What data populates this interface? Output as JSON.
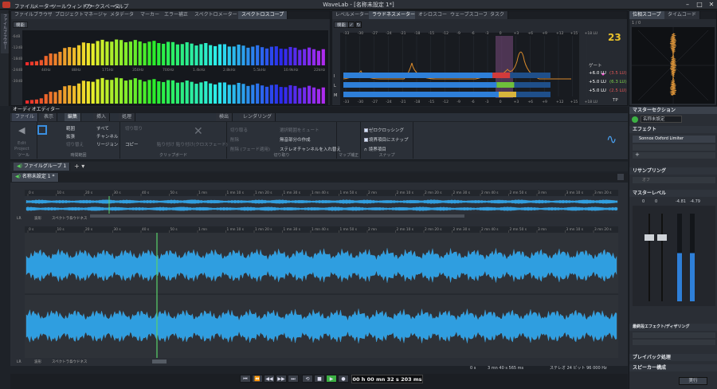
{
  "app": {
    "title": "WaveLab - [名称未設定 1*]"
  },
  "menu": [
    "ファイル",
    "メーター",
    "ツールウィンドウ",
    "ワークスペース",
    "ヘルプ"
  ],
  "side_strip": [
    "ファイルブラウザー"
  ],
  "spectro": {
    "tabs": [
      "ファイルブラウザー",
      "プロジェクトマネージャー",
      "メタデータ",
      "マーカー",
      "エラー補正",
      "スペクトロメーター",
      "スペクトロスコープ"
    ],
    "settings": "機能",
    "db_scale": [
      "-6dB",
      "-12dB",
      "-18dB",
      "-24dB",
      "-30dB"
    ],
    "freqs": [
      "44Hz",
      "88Hz",
      "175Hz",
      "350Hz",
      "700Hz",
      "1.4kHz",
      "2.8kHz",
      "5.5kHz",
      "10.9kHz",
      "22kHz"
    ]
  },
  "loud": {
    "tabs": [
      "レベルメーター",
      "ラウドネスメーター",
      "オシロスコープ",
      "ウェーブスコープ",
      "タスク"
    ],
    "settings": "機能",
    "scale": [
      "-33",
      "-30",
      "-27",
      "-24",
      "-21",
      "-18",
      "-15",
      "-12",
      "-9",
      "-6",
      "-3",
      "0",
      "+3",
      "+6",
      "+9",
      "+12",
      "+15",
      "+18 LU"
    ],
    "gate_label": "ゲート",
    "rows": [
      {
        "name": "I",
        "val1": "+6.0 LU",
        "val2": "(3.5 LU)",
        "color": "#d23b3b"
      },
      {
        "name": "L",
        "val1": "+5.0 LU",
        "val2": "(6.3 LU)",
        "color": "#6fbf3b"
      },
      {
        "name": "M",
        "val1": "+5.0 LU",
        "val2": "(2.5 LU)",
        "color": "#d9b43c"
      }
    ],
    "tp_label": "TP",
    "logo_num": "23"
  },
  "phase": {
    "tabs": [
      "位相スコープ",
      "タイムコード"
    ],
    "lr_label": "L   R",
    "corner": "1 / 0"
  },
  "editor": {
    "title": "オーディオエディター",
    "ribbon_tabs": [
      "ファイル",
      "表示",
      "編集",
      "挿入",
      "処理",
      "検出",
      "レンダリング"
    ],
    "groups": [
      {
        "label": "ツール",
        "items": [
          "Edit",
          "Project"
        ]
      },
      {
        "label": "時間範囲",
        "items": [
          "範囲",
          "拡張",
          "切り替え",
          "すべて",
          "チャンネル",
          "リージョン"
        ]
      },
      {
        "label": "クリップボード",
        "items": [
          "切り取り",
          "コピー",
          "貼り付け",
          "貼り付け(クロスフェード)"
        ]
      },
      {
        "label": "切り取り",
        "items": [
          "切り取る",
          "削除",
          "削除 (フェード適用)",
          "選択範囲をミュート",
          "無音部分の作成",
          "ステレオチャンネルを入れ替え"
        ]
      },
      {
        "label": "マップ補正",
        "items": [
          "ゼロクロッシング",
          "境界項目にスナップ",
          "境界項目"
        ]
      },
      {
        "label": "スナップ",
        "items": []
      }
    ],
    "file_group": "ファイルグループ 1",
    "file_tab": "名称未設定 1 *",
    "overview_ruler": [
      "0 s",
      "10 s",
      "20 s",
      "30 s",
      "40 s",
      "50 s",
      "1 mn",
      "1 mn 10 s",
      "1 mn 20 s",
      "1 mn 30 s",
      "1 mn 40 s",
      "1 mn 50 s",
      "2 mn",
      "2 mn 10 s",
      "2 mn 20 s",
      "2 mn 30 s",
      "2 mn 40 s",
      "2 mn 50 s",
      "3 mn",
      "3 mn 10 s",
      "3 mn 20 s"
    ],
    "main_ruler": [
      "0 s",
      "10 s",
      "20 s",
      "30 s",
      "40 s",
      "50 s",
      "1 mn",
      "1 mn 10 s",
      "1 mn 20 s",
      "1 mn 30 s",
      "1 mn 40 s",
      "1 mn 50 s",
      "2 mn",
      "2 mn 10 s",
      "2 mn 20 s",
      "2 mn 30 s",
      "2 mn 40 s",
      "2 mn 50 s",
      "3 mn",
      "3 mn 10 s",
      "3 mn 20 s"
    ],
    "view_tabs": [
      "LR",
      "波形",
      "スペクトラム",
      "ラウドネス"
    ],
    "status": {
      "pos": "0 s",
      "dur": "3 mn 40 s 565 ms",
      "fmt": "ステレオ 24 ビット 96 000 Hz"
    }
  },
  "transport": {
    "time": "00 h 00 mn 32 s 203 ms"
  },
  "master": {
    "title": "マスターセクション",
    "preset": "名称未設定",
    "effects_label": "エフェクト",
    "plugin": "Sonnox Oxford Limiter",
    "resampling_label": "リサンプリング",
    "resampling_off": "オフ",
    "level_label": "マスターレベル",
    "level_vals": [
      "0",
      "0",
      "-4.81",
      "-4.79"
    ],
    "final_label": "最終段エフェクト/ディザリング",
    "playback_label": "プレイバック処理",
    "speaker_label": "スピーカー構成",
    "render_label": "実行"
  }
}
